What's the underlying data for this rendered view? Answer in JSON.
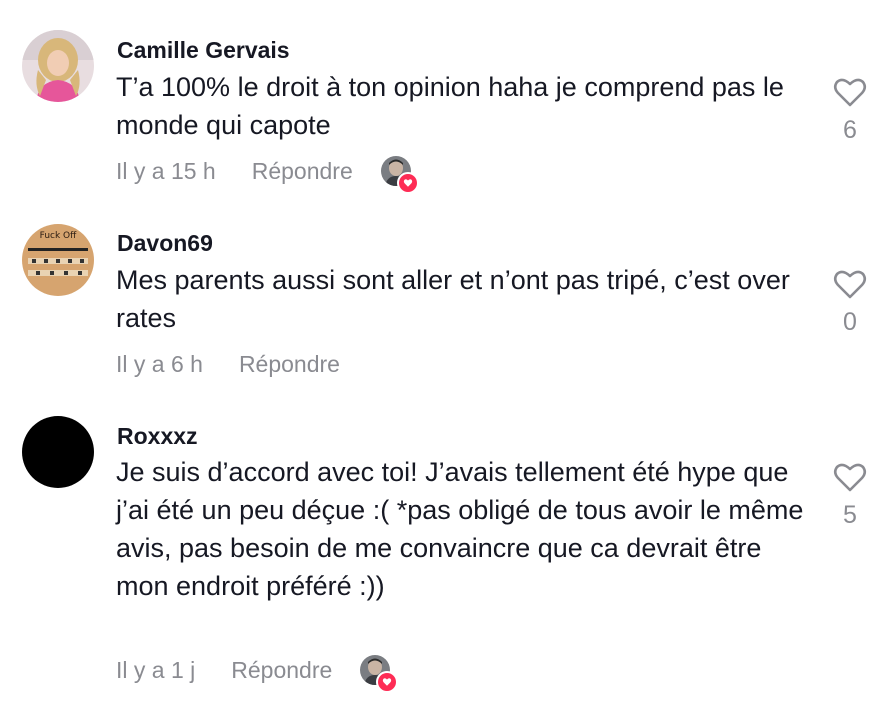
{
  "comments": [
    {
      "username": "Camille Gervais",
      "text": "T’a 100% le droit à ton opinion haha je comprend pas le monde qui capote",
      "time": "Il y a 15 h",
      "reply_label": "Répondre",
      "likes": "6",
      "liked_by_creator": true
    },
    {
      "username": "Davon69",
      "text": "Mes parents aussi sont aller et n’ont pas tripé, c’est over rates",
      "time": "Il y a 6 h",
      "reply_label": "Répondre",
      "likes": "0",
      "liked_by_creator": false,
      "avatar_text": "Fuck Off"
    },
    {
      "username": "Roxxxz",
      "text": "Je suis d’accord avec toi! J’avais tellement été hype que j’ai été un peu déçue :( *pas obligé de tous avoir le même avis, pas besoin de me convaincre que ca devrait être mon endroit préféré :))",
      "time": "Il y a 1 j",
      "reply_label": "Répondre",
      "likes": "5",
      "liked_by_creator": true
    }
  ],
  "colors": {
    "text": "#161823",
    "secondary": "#8a8b91",
    "heart_badge": "#fe2c55"
  },
  "icons": {
    "like": "heart-outline-icon",
    "creator_like_badge": "heart-badge-icon"
  }
}
